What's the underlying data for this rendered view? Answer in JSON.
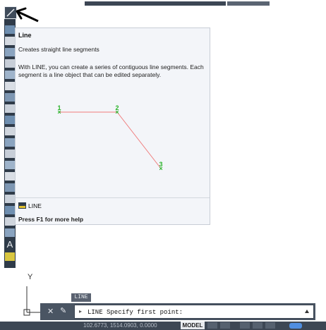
{
  "tooltip": {
    "title": "Line",
    "short_desc": "Creates straight line segments",
    "long_desc": "With LINE, you can create a series of contiguous line segments. Each segment is a line object that can be edited separately.",
    "points": [
      "1",
      "2",
      "3"
    ],
    "command_name": "LINE",
    "help": "Press F1 for more help"
  },
  "canvas": {
    "ucs_y_label": "Y"
  },
  "command_line": {
    "tag": "LINE",
    "text": "LINE Specify first point:"
  },
  "status_bar": {
    "coords": "102.6773, 1514.0903, 0.0000",
    "model": "MODEL"
  },
  "colors": {
    "toolbar_bg": "#2f3b49",
    "tooltip_bg": "#f3f5f9",
    "point_marker": "#2bb32b",
    "line_segment": "#f07c7c"
  }
}
